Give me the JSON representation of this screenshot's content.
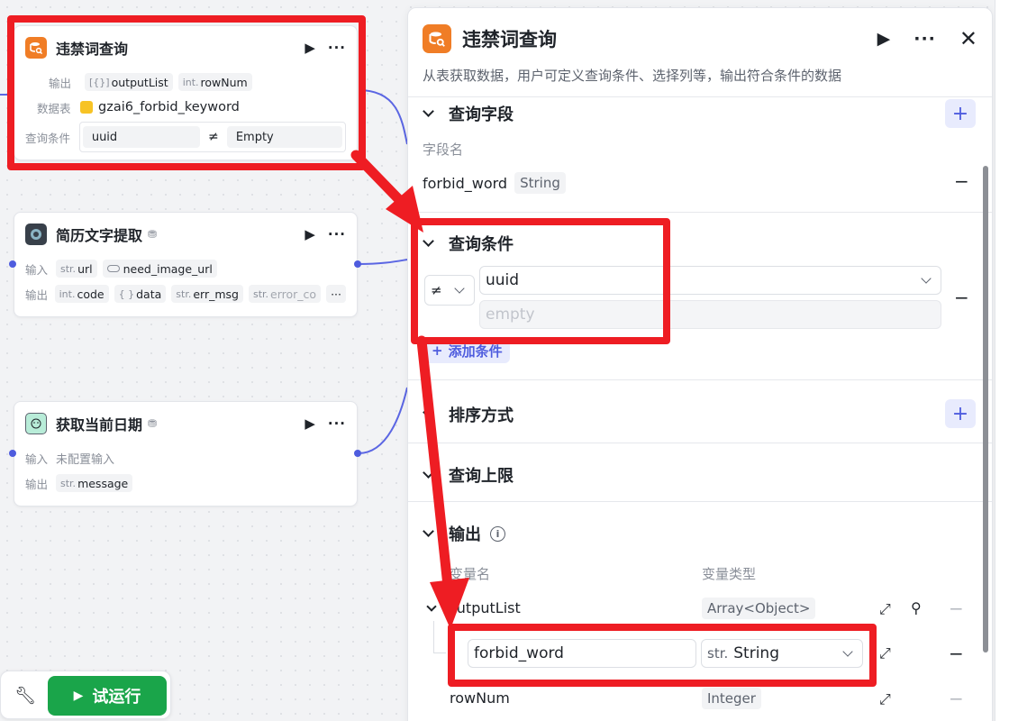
{
  "nodes": {
    "forbid_query": {
      "title": "违禁词查询",
      "output_label": "输出",
      "outputs": [
        {
          "type": "[{}]",
          "name": "outputList"
        },
        {
          "type": "int.",
          "name": "rowNum"
        }
      ],
      "table_label": "数据表",
      "table_name": "gzai6_forbid_keyword",
      "condition_label": "查询条件",
      "condition_field": "uuid",
      "condition_op": "≠",
      "condition_value": "Empty"
    },
    "resume": {
      "title": "简历文字提取",
      "input_label": "输入",
      "inputs": [
        {
          "type": "str.",
          "name": "url"
        },
        {
          "type": "",
          "name": "need_image_url"
        }
      ],
      "output_label": "输出",
      "outputs": [
        {
          "type": "int.",
          "name": "code"
        },
        {
          "type": "{ }",
          "name": "data"
        },
        {
          "type": "str.",
          "name": "err_msg"
        },
        {
          "type": "str.",
          "name": "error_co"
        }
      ]
    },
    "date": {
      "title": "获取当前日期",
      "input_label": "输入",
      "input_value": "未配置输入",
      "output_label": "输出",
      "outputs": [
        {
          "type": "str.",
          "name": "message"
        }
      ]
    }
  },
  "panel": {
    "title": "违禁词查询",
    "description": "从表获取数据，用户可定义查询条件、选择列等，输出符合条件的数据",
    "query_fields": {
      "title": "查询字段",
      "col_label": "字段名",
      "field_name": "forbid_word",
      "field_type": "String"
    },
    "conditions": {
      "title": "查询条件",
      "operator": "≠",
      "field": "uuid",
      "value_placeholder": "empty",
      "add_label": "添加条件"
    },
    "sort": {
      "title": "排序方式"
    },
    "limit": {
      "title": "查询上限"
    },
    "output": {
      "title": "输出",
      "col_name": "变量名",
      "col_type": "变量类型",
      "rows": [
        {
          "name": "outputList",
          "type": "Array<Object>"
        },
        {
          "name": "forbid_word",
          "type_prefix": "str.",
          "type": "String"
        },
        {
          "name": "rowNum",
          "type": "Integer"
        }
      ]
    }
  },
  "toolbar": {
    "run_label": "试运行"
  },
  "colors": {
    "accent": "#4e5cde",
    "highlight": "#ee1d23",
    "run": "#1aa54a",
    "node_icon": "#f07d26"
  }
}
